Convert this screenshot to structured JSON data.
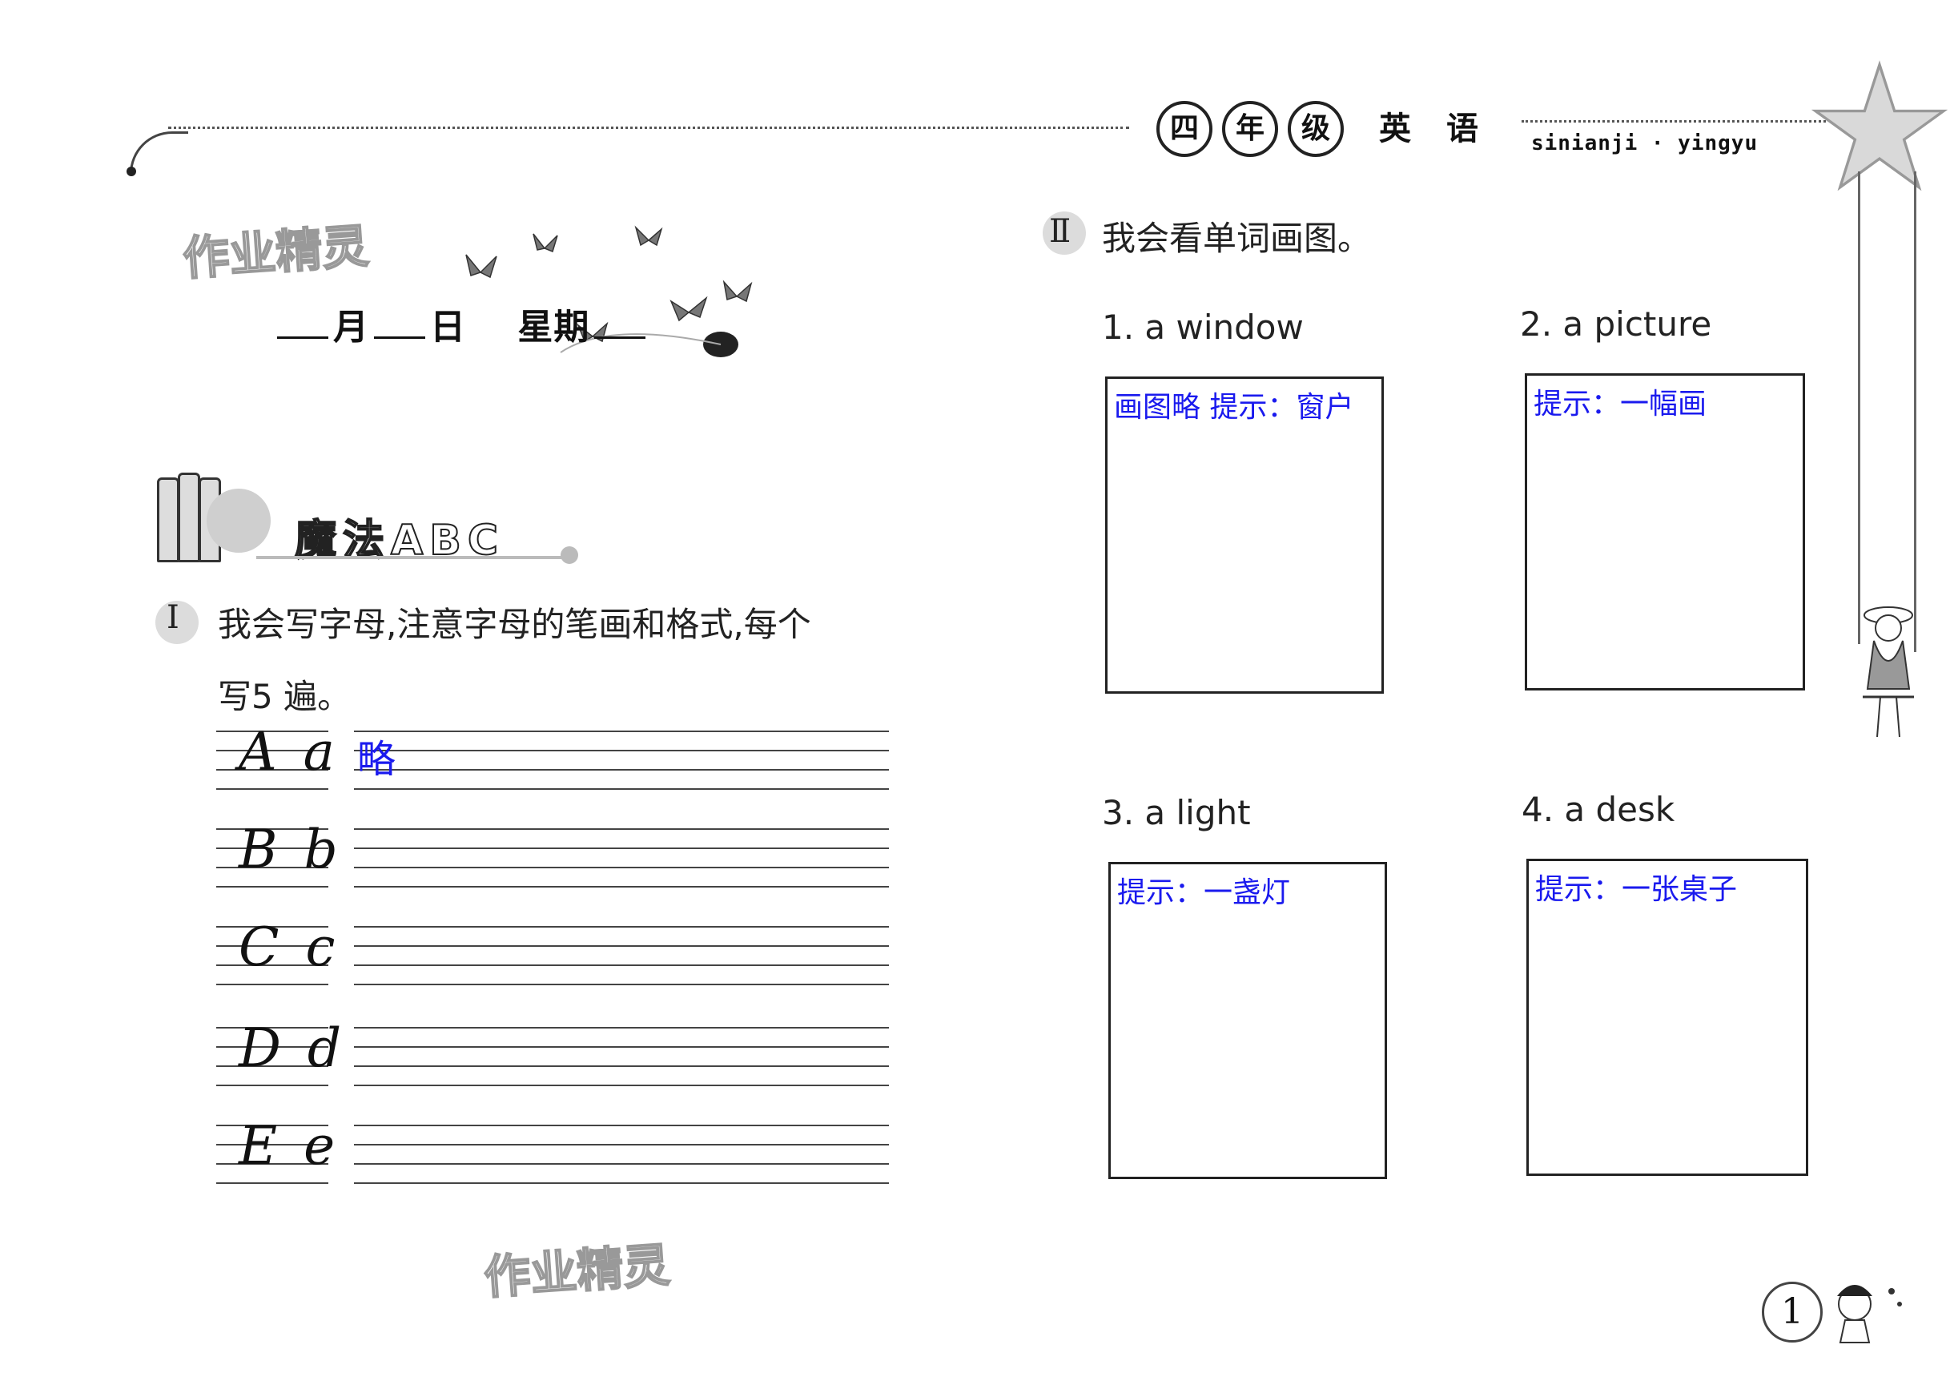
{
  "header": {
    "grade_chars": [
      "四",
      "年",
      "级"
    ],
    "subject_chars": [
      "英",
      "语"
    ],
    "pinyin": "sinianji · yingyu"
  },
  "watermarks": [
    "作业精灵",
    "作业精灵"
  ],
  "date_line": {
    "month": "月",
    "day": "日",
    "weekday": "星期"
  },
  "section": {
    "title": "魔法ABC"
  },
  "exercise1": {
    "number": "Ⅰ",
    "instruction_line1": "我会写字母,注意字母的笔画和格式,每个",
    "instruction_line2": "写5 遍。",
    "rows": [
      {
        "letters": "A a"
      },
      {
        "letters": "B b"
      },
      {
        "letters": "C c"
      },
      {
        "letters": "D d"
      },
      {
        "letters": "E e"
      }
    ],
    "answer": "略"
  },
  "exercise2": {
    "number": "Ⅱ",
    "instruction": "我会看单词画图。",
    "items": [
      {
        "label": "1. a window",
        "hint": "画图略 提示：窗户"
      },
      {
        "label": "2. a picture",
        "hint": "提示：一幅画"
      },
      {
        "label": "3. a light",
        "hint": "提示：一盏灯"
      },
      {
        "label": "4. a desk",
        "hint": "提示：一张桌子"
      }
    ]
  },
  "page_number": "1"
}
